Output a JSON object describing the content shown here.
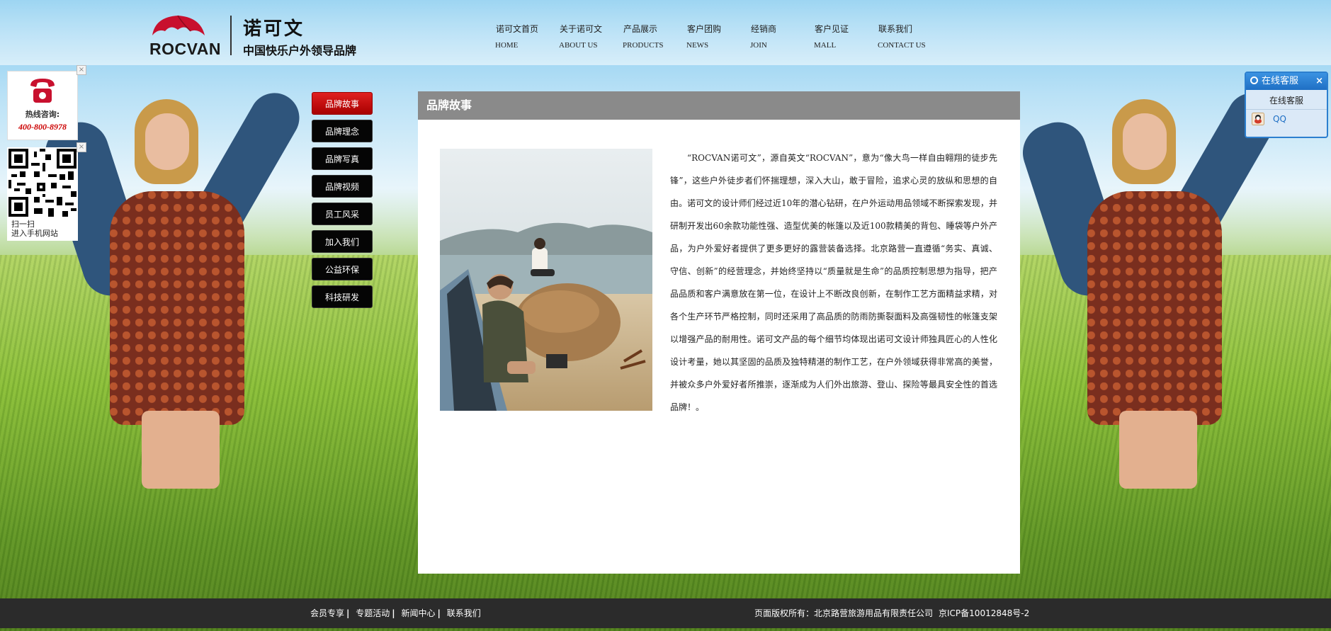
{
  "brand": {
    "name_en": "ROCVAN",
    "name_cn": "诺可文",
    "slogan": "中国快乐户外领导品牌"
  },
  "nav": [
    {
      "cn": "诺可文首页",
      "en": "HOME"
    },
    {
      "cn": "关于诺可文",
      "en": "ABOUT US"
    },
    {
      "cn": "产品展示",
      "en": "PRODUCTS"
    },
    {
      "cn": "客户团购",
      "en": "NEWS"
    },
    {
      "cn": "经销商",
      "en": "JOIN"
    },
    {
      "cn": "客户见证",
      "en": "MALL"
    },
    {
      "cn": "联系我们",
      "en": "CONTACT US"
    }
  ],
  "hotline": {
    "label": "热线咨询:",
    "number": "400-800-8978"
  },
  "qr": {
    "line1": "扫一扫",
    "line2": "进入手机网站"
  },
  "side_menu": [
    {
      "label": "品牌故事",
      "active": true
    },
    {
      "label": "品牌理念",
      "active": false
    },
    {
      "label": "品牌写真",
      "active": false
    },
    {
      "label": "品牌视频",
      "active": false
    },
    {
      "label": "员工风采",
      "active": false
    },
    {
      "label": "加入我们",
      "active": false
    },
    {
      "label": "公益环保",
      "active": false
    },
    {
      "label": "科技研发",
      "active": false
    }
  ],
  "panel": {
    "title": "品牌故事",
    "article": "“ROCVAN诺可文”，源自英文“ROCVAN”，意为“像大鸟一样自由翱翔的徒步先锋”，这些户外徒步者们怀揣理想，深入大山，敢于冒险，追求心灵的放纵和思想的自由。诺可文的设计师们经过近10年的潜心钻研，在户外运动用品领域不断探索发现，并研制开发出60余款功能性强、造型优美的帐篷以及近100款精美的背包、睡袋等户外产品，为户外爱好者提供了更多更好的露营装备选择。北京路营一直遵循“务实、真诚、守信、创新”的经营理念，并始终坚持以“质量就是生命”的品质控制思想为指导，把产品品质和客户满意放在第一位，在设计上不断改良创新，在制作工艺方面精益求精，对各个生产环节严格控制，同时还采用了高品质的防雨防撕裂面料及高强韧性的帐篷支架以增强产品的耐用性。诺可文产品的每个细节均体现出诺可文设计师独具匠心的人性化设计考量，她以其坚固的品质及独特精湛的制作工艺，在户外领域获得非常高的美誉，并被众多户外爱好者所推崇，逐渐成为人们外出旅游、登山、探险等最具安全性的首选品牌！。"
  },
  "chat": {
    "title": "在线客服",
    "close": "×",
    "subtitle": "在线客服",
    "qq_label": "QQ"
  },
  "footer": {
    "links": [
      "会员专享",
      "专题活动",
      "新闻中心",
      "联系我们"
    ],
    "separator": "|",
    "copyright": "页面版权所有：北京路营旅游用品有限责任公司",
    "icp": "京ICP备10012848号-2"
  },
  "colors": {
    "accent_red": "#c00000",
    "panel_title_bg": "#8a8a8a",
    "footer_bg": "#2b2b2b",
    "chat_blue": "#2c7fcf"
  },
  "icons": [
    "umbrella-logo-icon",
    "phone-icon",
    "close-icon",
    "qr-code-icon",
    "chat-bubble-icon",
    "qq-icon"
  ]
}
